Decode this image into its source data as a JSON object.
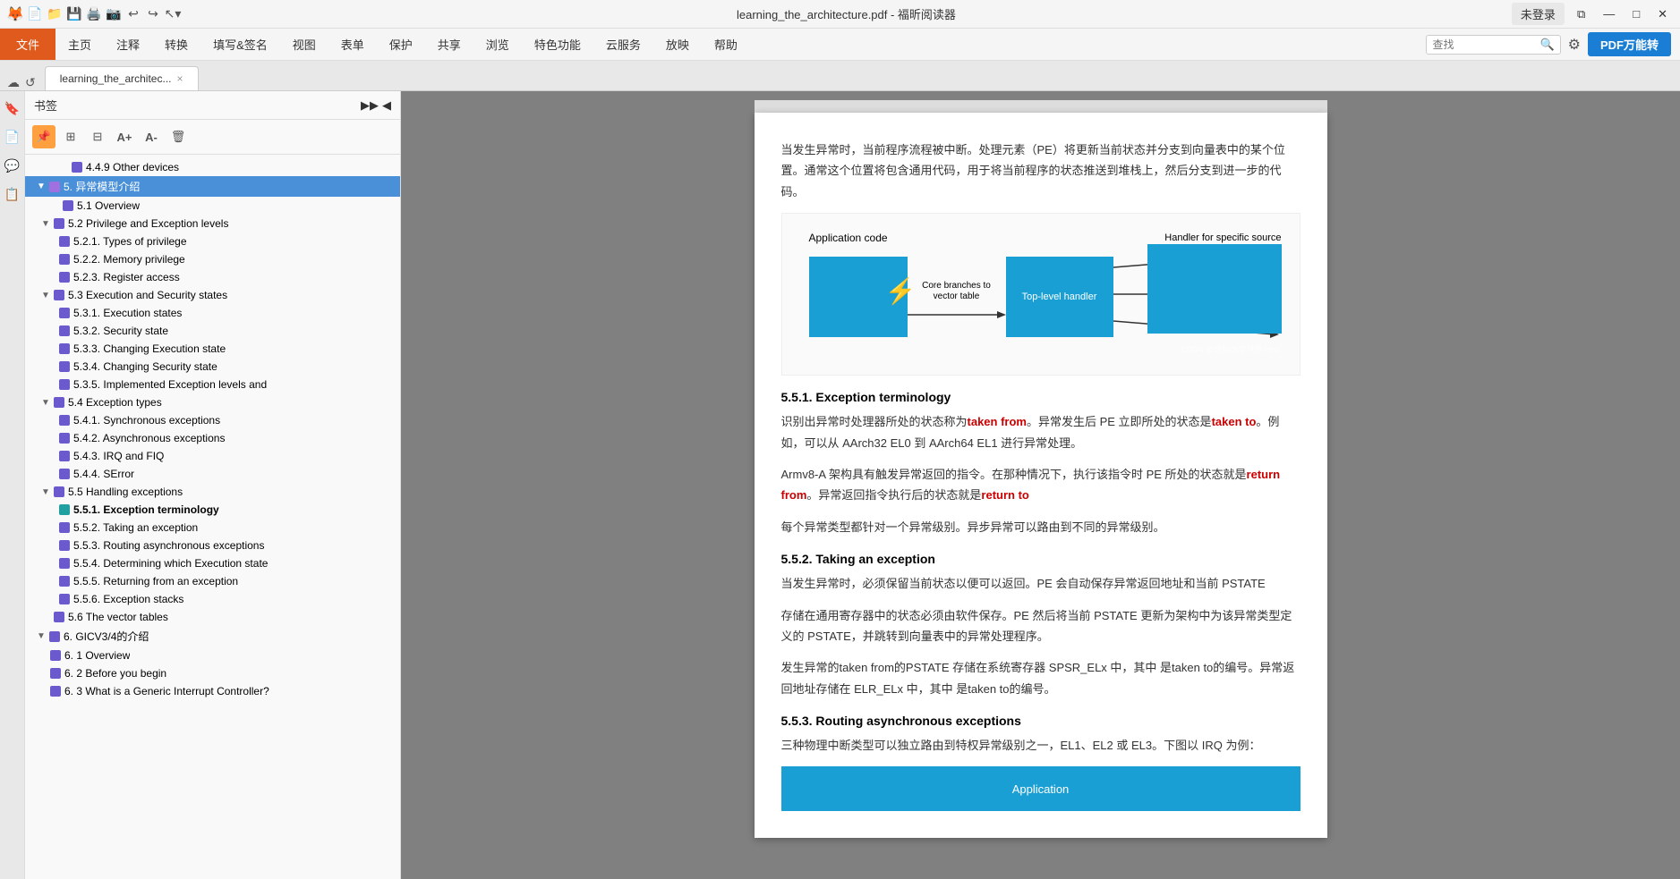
{
  "titleBar": {
    "title": "learning_the_architecture.pdf - 福昕阅读器",
    "loginBtn": "未登录"
  },
  "menuBar": {
    "file": "文件",
    "items": [
      "主页",
      "注释",
      "转换",
      "填写&签名",
      "视图",
      "表单",
      "保护",
      "共享",
      "浏览",
      "特色功能",
      "云服务",
      "放映",
      "帮助"
    ],
    "pdfBtn": "PDF万能转"
  },
  "tab": {
    "label": "learning_the_architec...",
    "close": "×"
  },
  "sidebar": {
    "title": "书签",
    "tools": [
      "📌",
      "A+",
      "A-",
      "🗑️"
    ]
  },
  "tree": {
    "items": [
      {
        "id": "4_4_9",
        "label": "4.4.9 Other devices",
        "level": 2,
        "hasArrow": false,
        "bullet": "purple",
        "expanded": false
      },
      {
        "id": "5",
        "label": "5. 异常模型介绍",
        "level": 0,
        "hasArrow": true,
        "bullet": "purple",
        "expanded": true,
        "selected": true,
        "highlighted": true
      },
      {
        "id": "5_1",
        "label": "5.1 Overview",
        "level": 1,
        "hasArrow": false,
        "bullet": "purple",
        "expanded": false
      },
      {
        "id": "5_2",
        "label": "5.2 Privilege and Exception levels",
        "level": 1,
        "hasArrow": true,
        "bullet": "purple",
        "expanded": true
      },
      {
        "id": "5_2_1",
        "label": "5.2.1. Types of privilege",
        "level": 2,
        "hasArrow": false,
        "bullet": "purple"
      },
      {
        "id": "5_2_2",
        "label": "5.2.2. Memory privilege",
        "level": 2,
        "hasArrow": false,
        "bullet": "purple"
      },
      {
        "id": "5_2_3",
        "label": "5.2.3. Register access",
        "level": 2,
        "hasArrow": false,
        "bullet": "purple"
      },
      {
        "id": "5_3",
        "label": "5.3 Execution and Security states",
        "level": 1,
        "hasArrow": true,
        "bullet": "purple",
        "expanded": true
      },
      {
        "id": "5_3_1",
        "label": "5.3.1. Execution states",
        "level": 2,
        "hasArrow": false,
        "bullet": "purple"
      },
      {
        "id": "5_3_2",
        "label": "5.3.2. Security state",
        "level": 2,
        "hasArrow": false,
        "bullet": "purple"
      },
      {
        "id": "5_3_3",
        "label": "5.3.3. Changing Execution state",
        "level": 2,
        "hasArrow": false,
        "bullet": "purple"
      },
      {
        "id": "5_3_4",
        "label": "5.3.4. Changing Security state",
        "level": 2,
        "hasArrow": false,
        "bullet": "purple"
      },
      {
        "id": "5_3_5",
        "label": "5.3.5. Implemented Exception levels and",
        "level": 2,
        "hasArrow": false,
        "bullet": "purple"
      },
      {
        "id": "5_4",
        "label": "5.4 Exception types",
        "level": 1,
        "hasArrow": true,
        "bullet": "purple",
        "expanded": true
      },
      {
        "id": "5_4_1",
        "label": "5.4.1. Synchronous exceptions",
        "level": 2,
        "hasArrow": false,
        "bullet": "purple"
      },
      {
        "id": "5_4_2",
        "label": "5.4.2. Asynchronous exceptions",
        "level": 2,
        "hasArrow": false,
        "bullet": "purple"
      },
      {
        "id": "5_4_3",
        "label": "5.4.3. IRQ and FIQ",
        "level": 2,
        "hasArrow": false,
        "bullet": "purple"
      },
      {
        "id": "5_4_4",
        "label": "5.4.4. SError",
        "level": 2,
        "hasArrow": false,
        "bullet": "purple"
      },
      {
        "id": "5_5",
        "label": "5.5 Handling exceptions",
        "level": 1,
        "hasArrow": true,
        "bullet": "purple",
        "expanded": true
      },
      {
        "id": "5_5_1",
        "label": "5.5.1. Exception terminology",
        "level": 2,
        "hasArrow": false,
        "bullet": "teal",
        "active": true
      },
      {
        "id": "5_5_2",
        "label": "5.5.2. Taking an exception",
        "level": 2,
        "hasArrow": false,
        "bullet": "purple"
      },
      {
        "id": "5_5_3",
        "label": "5.5.3. Routing asynchronous exceptions",
        "level": 2,
        "hasArrow": false,
        "bullet": "purple"
      },
      {
        "id": "5_5_4",
        "label": "5.5.4. Determining which Execution state",
        "level": 2,
        "hasArrow": false,
        "bullet": "purple"
      },
      {
        "id": "5_5_5",
        "label": "5.5.5. Returning from an exception",
        "level": 2,
        "hasArrow": false,
        "bullet": "purple"
      },
      {
        "id": "5_5_6",
        "label": "5.5.6. Exception stacks",
        "level": 2,
        "hasArrow": false,
        "bullet": "purple"
      },
      {
        "id": "5_6",
        "label": "5.6 The vector tables",
        "level": 1,
        "hasArrow": false,
        "bullet": "purple"
      },
      {
        "id": "6",
        "label": "6. GICV3/4的介绍",
        "level": 0,
        "hasArrow": true,
        "bullet": "purple",
        "expanded": true
      },
      {
        "id": "6_1",
        "label": "6. 1 Overview",
        "level": 1,
        "hasArrow": false,
        "bullet": "purple"
      },
      {
        "id": "6_2",
        "label": "6. 2 Before you begin",
        "level": 1,
        "hasArrow": false,
        "bullet": "purple"
      },
      {
        "id": "6_3",
        "label": "6. 3 What is a Generic Interrupt Controller?",
        "level": 1,
        "hasArrow": false,
        "bullet": "purple"
      }
    ]
  },
  "content": {
    "introText": "当发生异常时，当前程序流程被中断。处理元素（PE）将更新当前状态并分支到向量表中的某个位置。通常这个位置将包含通用代码，用于将当前程序的状态推送到堆栈上，然后分支到进一步的代码。",
    "diagram": {
      "appLabel": "Application code",
      "handlerTopLabel": "Handler for specific source",
      "branch1": "Core branches to vector table",
      "topHandler": "Top-level handler",
      "watermark": "CSDN @代码改变世界 ctrw"
    },
    "section551": {
      "title": "5.5.1. Exception terminology",
      "p1": "识别出异常时处理器所处的状态称为",
      "takenFrom": "taken from",
      "p1b": "。异常发生后 PE 立即所处的状态是",
      "takenTo": "taken to",
      "p1c": "。例如，可以从 AArch32 EL0 到 AArch64 EL1 进行异常处理。",
      "p2": "Armv8-A 架构具有触发异常返回的指令。在那种情况下，执行该指令时 PE 所处的状态就是",
      "returnFrom": "return from",
      "p2b": "。异常返回指令执行后的状态就是",
      "returnTo": "return to"
    },
    "p3": "每个异常类型都针对一个异常级别。异步异常可以路由到不同的异常级别。",
    "section552": {
      "title": "5.5.2. Taking an exception",
      "p1": "当发生异常时，必须保留当前状态以便可以返回。PE 会自动保存异常返回地址和当前 PSTATE",
      "p2": "存储在通用寄存器中的状态必须由软件保存。PE 然后将当前 PSTATE 更新为架构中为该异常类型定义的 PSTATE，并跳转到向量表中的异常处理程序。",
      "p3": "发生异常的taken from的PSTATE 存储在系统寄存器 SPSR_ELx 中，其中 是taken to的编号。异常返回地址存储在 ELR_ELx 中，其中 是taken to的编号。"
    },
    "section553": {
      "title": "5.5.3. Routing asynchronous exceptions",
      "p1": "三种物理中断类型可以独立路由到特权异常级别之一，EL1、EL2 或 EL3。下图以 IRQ 为例："
    }
  }
}
